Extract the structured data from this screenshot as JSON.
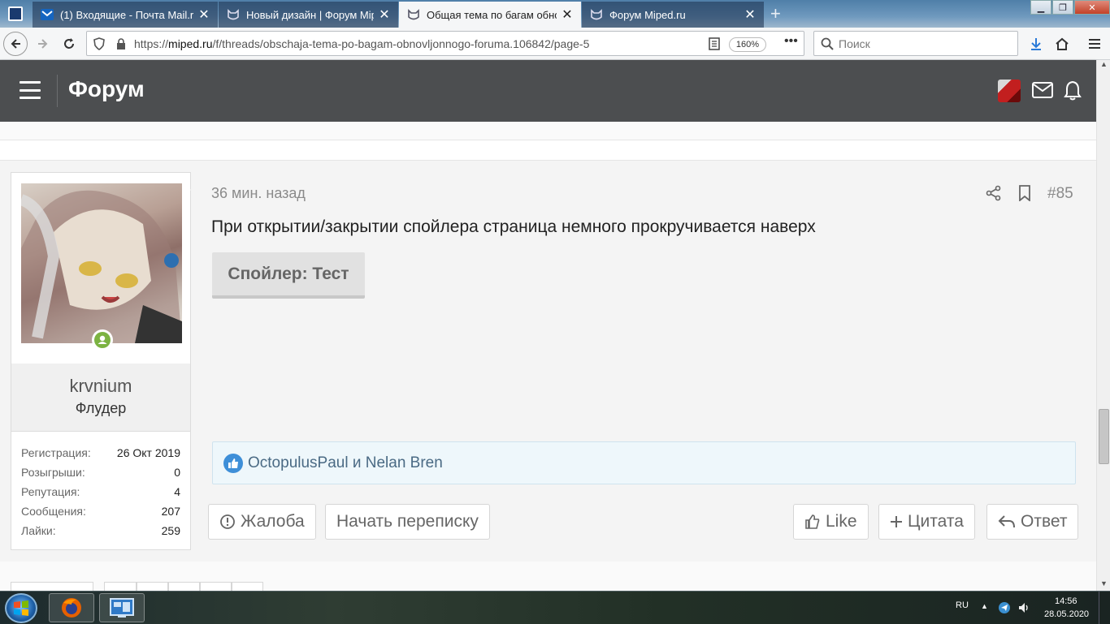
{
  "browser": {
    "tabs": [
      {
        "title": "(1) Входящие - Почта Mail.ru",
        "active": false
      },
      {
        "title": "Новый дизайн | Форум Miped",
        "active": false
      },
      {
        "title": "Общая тема по багам обновл",
        "active": true
      },
      {
        "title": "Форум Miped.ru",
        "active": false
      }
    ],
    "url_domain": "miped.ru",
    "url_prefix": "https://",
    "url_path": "/f/threads/obschaja-tema-po-bagam-obnovljonnogo-foruma.106842/page-5",
    "zoom": "160%",
    "search_placeholder": "Поиск"
  },
  "site": {
    "title": "Форум"
  },
  "post": {
    "time": "36 мин. назад",
    "number": "#85",
    "text": "При открытии/закрытии спойлера страница немного прокручивается наверх",
    "spoiler_label": "Спойлер: Тест",
    "likes_text": "OctopulusPaul и Nelan Bren",
    "buttons": {
      "report": "Жалоба",
      "conversation": "Начать переписку",
      "like": "Like",
      "quote": "Цитата",
      "reply": "Ответ"
    }
  },
  "user": {
    "name": "krvnium",
    "title": "Флудер",
    "stats": [
      {
        "label": "Регистрация:",
        "value": "26 Окт 2019"
      },
      {
        "label": "Розыгрыши:",
        "value": "0"
      },
      {
        "label": "Репутация:",
        "value": "4"
      },
      {
        "label": "Сообщения:",
        "value": "207"
      },
      {
        "label": "Лайки:",
        "value": "259"
      }
    ]
  },
  "taskbar": {
    "lang": "RU",
    "time": "14:56",
    "date": "28.05.2020"
  },
  "colors": {
    "header": "#4c4e50",
    "online": "#7cb342",
    "like_blue": "#3e8fd8"
  }
}
